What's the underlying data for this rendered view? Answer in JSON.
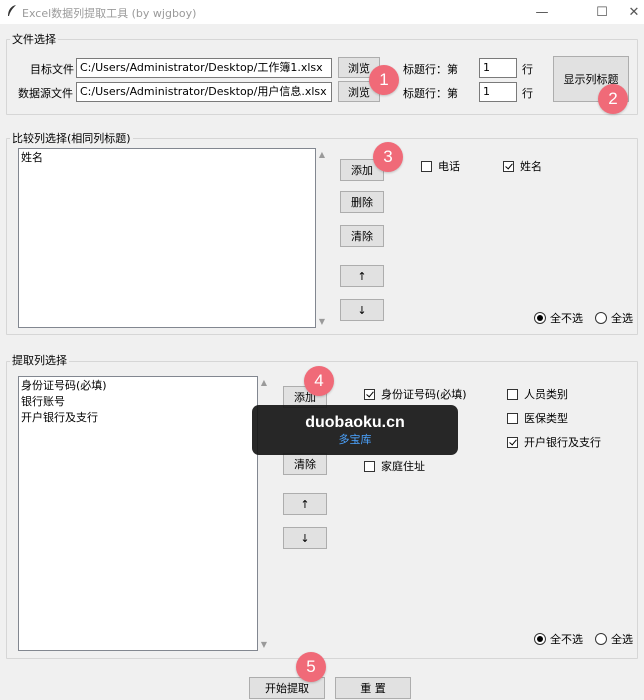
{
  "window": {
    "title": "Excel数据列提取工具 (by wjgboy)",
    "minimize": "—",
    "maximize": "☐",
    "close": "✕"
  },
  "file_section": {
    "title": "文件选择",
    "target_label": "目标文件",
    "target_path": "C:/Users/Administrator/Desktop/工作簿1.xlsx",
    "source_label": "数据源文件",
    "source_path": "C:/Users/Administrator/Desktop/用户信息.xlsx",
    "browse": "浏览",
    "header_row_label": "标题行：第",
    "target_header_row": "1",
    "source_header_row": "1",
    "row_suffix": "行",
    "show_headers": "显示列标题"
  },
  "compare_section": {
    "title": "比较列选择(相同列标题)",
    "selected": [
      "姓名"
    ],
    "add": "添加",
    "delete": "删除",
    "clear": "清除",
    "up": "↑",
    "down": "↓",
    "options": [
      {
        "label": "电话",
        "checked": false
      },
      {
        "label": "姓名",
        "checked": true
      }
    ],
    "deselect_all": "全不选",
    "select_all": "全选"
  },
  "extract_section": {
    "title": "提取列选择",
    "selected": [
      "身份证号码(必填)",
      "银行账号",
      "开户银行及支行"
    ],
    "add": "添加",
    "clear": "清除",
    "up": "↑",
    "down": "↓",
    "options": [
      {
        "label": "身份证号码(必填)",
        "checked": true
      },
      {
        "label": "人员类别",
        "checked": false
      },
      {
        "label": "医保类型",
        "checked": false
      },
      {
        "label": "开户银行及支行",
        "checked": true
      },
      {
        "label": "家庭住址",
        "checked": false
      }
    ],
    "deselect_all": "全不选",
    "select_all": "全选"
  },
  "bottom": {
    "start": "开始提取",
    "reset": "重 置"
  },
  "badges": [
    "1",
    "2",
    "3",
    "4",
    "5"
  ],
  "watermark": {
    "line1": "duobaoku.cn",
    "line2": "多宝库"
  },
  "colors": {
    "badge": "#f06a78",
    "watermark_bg": "#161616",
    "watermark_accent": "#4ba3ff"
  }
}
